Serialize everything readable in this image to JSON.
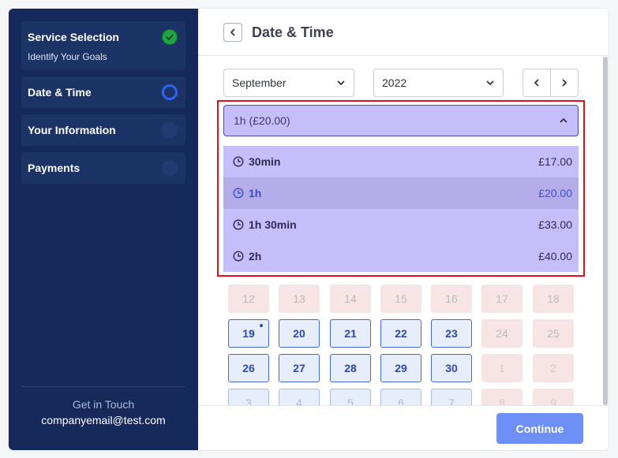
{
  "sidebar": {
    "steps": [
      {
        "label": "Service Selection",
        "sub": "Identify Your Goals",
        "state": "done"
      },
      {
        "label": "Date & Time",
        "state": "active"
      },
      {
        "label": "Your Information",
        "state": "pending"
      },
      {
        "label": "Payments",
        "state": "pending"
      }
    ],
    "contact_title": "Get in Touch",
    "contact_email": "companyemail@test.com"
  },
  "header": {
    "title": "Date & Time",
    "back_icon": "chevron-left-icon"
  },
  "filters": {
    "month": "September",
    "year": "2022"
  },
  "duration": {
    "selected": "1h  (£20.00)",
    "options": [
      {
        "name": "30min",
        "price": "£17.00",
        "selected": false
      },
      {
        "name": "1h",
        "price": "£20.00",
        "selected": true
      },
      {
        "name": "1h 30min",
        "price": "£33.00",
        "selected": false
      },
      {
        "name": "2h",
        "price": "£40.00",
        "selected": false
      }
    ]
  },
  "calendar": {
    "rows": [
      [
        {
          "d": "12",
          "s": "unavail"
        },
        {
          "d": "13",
          "s": "unavail"
        },
        {
          "d": "14",
          "s": "unavail"
        },
        {
          "d": "15",
          "s": "unavail"
        },
        {
          "d": "16",
          "s": "unavail"
        },
        {
          "d": "17",
          "s": "unavail"
        },
        {
          "d": "18",
          "s": "unavail"
        }
      ],
      [
        {
          "d": "19",
          "s": "avail",
          "today": true
        },
        {
          "d": "20",
          "s": "avail"
        },
        {
          "d": "21",
          "s": "avail"
        },
        {
          "d": "22",
          "s": "avail"
        },
        {
          "d": "23",
          "s": "avail"
        },
        {
          "d": "24",
          "s": "unavail"
        },
        {
          "d": "25",
          "s": "unavail"
        }
      ],
      [
        {
          "d": "26",
          "s": "avail"
        },
        {
          "d": "27",
          "s": "avail"
        },
        {
          "d": "28",
          "s": "avail"
        },
        {
          "d": "29",
          "s": "avail"
        },
        {
          "d": "30",
          "s": "avail"
        },
        {
          "d": "1",
          "s": "nextun"
        },
        {
          "d": "2",
          "s": "nextun"
        }
      ],
      [
        {
          "d": "3",
          "s": "next"
        },
        {
          "d": "4",
          "s": "next"
        },
        {
          "d": "5",
          "s": "next"
        },
        {
          "d": "6",
          "s": "next"
        },
        {
          "d": "7",
          "s": "next"
        },
        {
          "d": "8",
          "s": "nextun"
        },
        {
          "d": "9",
          "s": "nextun"
        }
      ]
    ]
  },
  "footer": {
    "continue_label": "Continue"
  },
  "colors": {
    "sidebar_bg": "#15295a",
    "accent": "#2f63f2",
    "dropdown_bg": "#c6befa",
    "highlight": "#e3101c",
    "continue_bg": "#6e8ff6"
  }
}
